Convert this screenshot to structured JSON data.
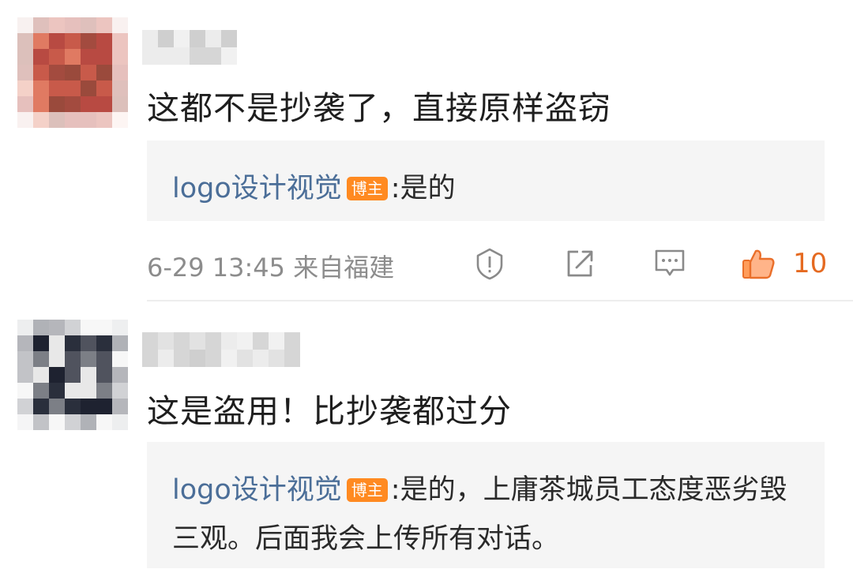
{
  "comments": [
    {
      "text": "这都不是抄袭了，直接原样盗窃",
      "reply": {
        "author": "logo设计视觉",
        "badge": "博主",
        "separator": ":",
        "text": "是的"
      },
      "meta": "6-29 13:45  来自福建",
      "likes": "10",
      "avatar_colors": [
        "#c85a4a",
        "#b84a42",
        "#9a4a3c",
        "#e07a62",
        "#a34b3f"
      ]
    },
    {
      "text": "这是盗用！比抄袭都过分",
      "reply": {
        "author": "logo设计视觉",
        "badge": "博主",
        "separator": ":",
        "text": "是的，上庸茶城员工态度恶劣毁三观。后面我会上传所有对话。"
      },
      "avatar_colors": [
        "#2a2f3c",
        "#50535e",
        "#7c7f86",
        "#e8e8e8",
        "#1e2230"
      ]
    }
  ],
  "icons": [
    "report-icon",
    "share-icon",
    "reply-icon",
    "like-icon"
  ],
  "colors": {
    "reply_author": "#4b6e98",
    "badge_bg": "#ff8a21",
    "like_active": "#e56a21",
    "reply_bg": "#f5f5f5",
    "meta_text": "#8c8c8c"
  }
}
